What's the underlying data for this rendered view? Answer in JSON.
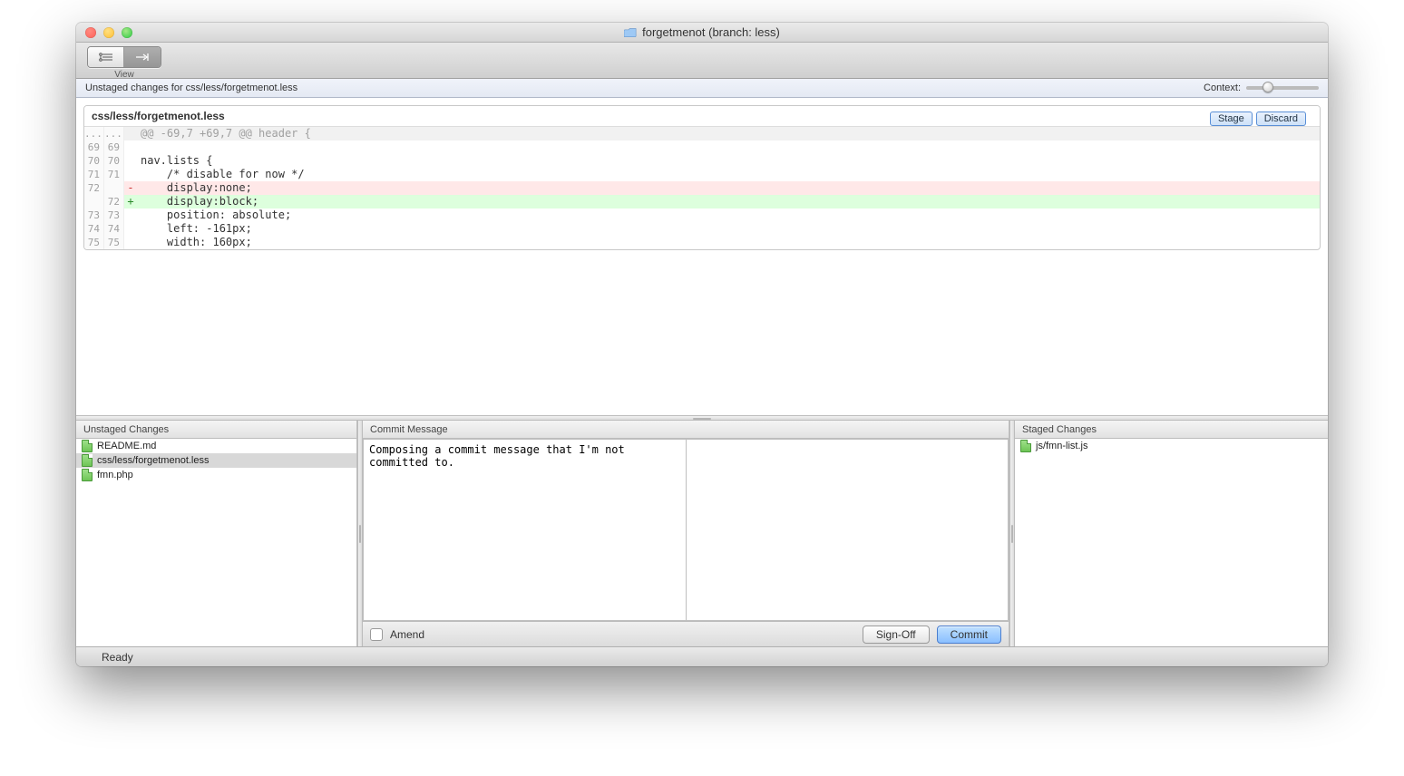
{
  "window": {
    "title": "forgetmenot (branch: less)"
  },
  "toolbar": {
    "view_label": "View"
  },
  "subbar": {
    "left": "Unstaged changes for css/less/forgetmenot.less",
    "context_label": "Context:"
  },
  "diff": {
    "file": "css/less/forgetmenot.less",
    "stage_btn": "Stage",
    "discard_btn": "Discard",
    "rows": [
      {
        "oldno": "...",
        "newno": "...",
        "sign": "",
        "text": "@@ -69,7 +69,7 @@ header {",
        "cls": "hunkhead"
      },
      {
        "oldno": "69",
        "newno": "69",
        "sign": "",
        "text": "",
        "cls": ""
      },
      {
        "oldno": "70",
        "newno": "70",
        "sign": "",
        "text": "nav.lists {",
        "cls": ""
      },
      {
        "oldno": "71",
        "newno": "71",
        "sign": "",
        "text": "    /* disable for now */",
        "cls": ""
      },
      {
        "oldno": "72",
        "newno": "",
        "sign": "-",
        "text": "    display:none;",
        "cls": "removed"
      },
      {
        "oldno": "",
        "newno": "72",
        "sign": "+",
        "text": "    display:block;",
        "cls": "added"
      },
      {
        "oldno": "73",
        "newno": "73",
        "sign": "",
        "text": "    position: absolute;",
        "cls": ""
      },
      {
        "oldno": "74",
        "newno": "74",
        "sign": "",
        "text": "    left: -161px;",
        "cls": ""
      },
      {
        "oldno": "75",
        "newno": "75",
        "sign": "",
        "text": "    width: 160px;",
        "cls": ""
      }
    ]
  },
  "panels": {
    "unstaged_label": "Unstaged Changes",
    "commit_label": "Commit Message",
    "staged_label": "Staged Changes",
    "unstaged_files": [
      {
        "name": "README.md",
        "selected": false
      },
      {
        "name": "css/less/forgetmenot.less",
        "selected": true
      },
      {
        "name": "fmn.php",
        "selected": false
      }
    ],
    "staged_files": [
      {
        "name": "js/fmn-list.js",
        "selected": false
      }
    ]
  },
  "commit": {
    "message": "Composing a commit message that I'm not committed to.",
    "amend_label": "Amend",
    "signoff_label": "Sign-Off",
    "commit_label": "Commit"
  },
  "status": {
    "text": "Ready"
  }
}
